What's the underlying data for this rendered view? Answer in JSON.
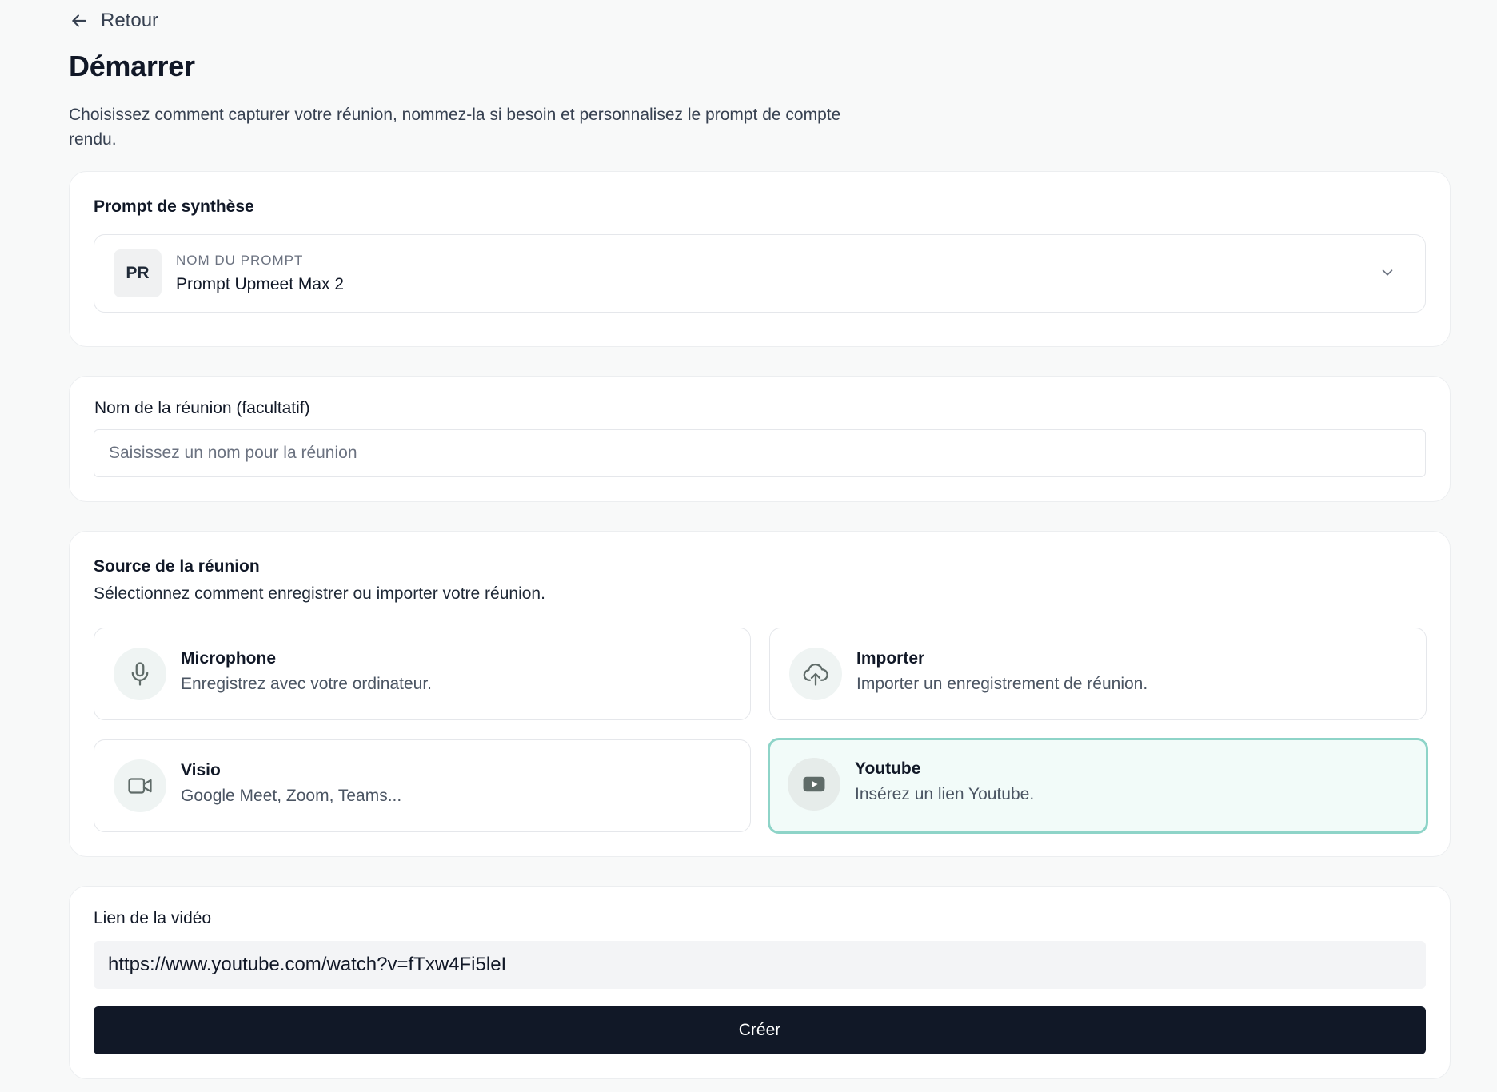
{
  "nav": {
    "back_label": "Retour"
  },
  "header": {
    "title": "Démarrer",
    "description": "Choisissez comment capturer votre réunion, nommez-la si besoin et personnalisez le prompt de compte rendu."
  },
  "prompt_section": {
    "title": "Prompt de synthèse",
    "avatar_initials": "PR",
    "caption": "NOM DU PROMPT",
    "selected_value": "Prompt Upmeet Max 2"
  },
  "name_section": {
    "label": "Nom de la réunion (facultatif)",
    "placeholder": "Saisissez un nom pour la réunion",
    "value": ""
  },
  "source_section": {
    "title": "Source de la réunion",
    "description": "Sélectionnez comment enregistrer ou importer votre réunion.",
    "selected": "youtube",
    "options": [
      {
        "id": "microphone",
        "icon": "microphone-icon",
        "title": "Microphone",
        "subtitle": "Enregistrez avec votre ordinateur."
      },
      {
        "id": "import",
        "icon": "cloud-upload-icon",
        "title": "Importer",
        "subtitle": "Importer un enregistrement de réunion."
      },
      {
        "id": "visio",
        "icon": "video-camera-icon",
        "title": "Visio",
        "subtitle": "Google Meet, Zoom, Teams..."
      },
      {
        "id": "youtube",
        "icon": "youtube-icon",
        "title": "Youtube",
        "subtitle": "Insérez un lien Youtube."
      }
    ]
  },
  "link_section": {
    "label": "Lien de la vidéo",
    "value": "https://www.youtube.com/watch?v=fTxw4Fi5leI",
    "submit_label": "Créer"
  },
  "colors": {
    "primary_button": "#111827",
    "selected_border": "#8ed4c8",
    "selected_background": "#f2fbf9",
    "page_background": "#f8f9f9"
  }
}
